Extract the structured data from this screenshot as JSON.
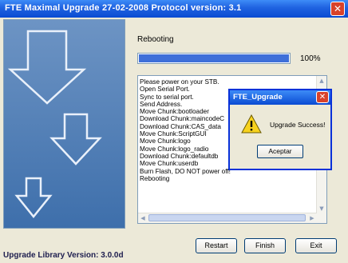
{
  "window": {
    "title": "FTE Maximal Upgrade   27-02-2008 Protocol version: 3.1",
    "close_glyph": "✕"
  },
  "status": {
    "label": "Rebooting",
    "progress_fraction": 1.0,
    "progress_text": "100%"
  },
  "log": {
    "lines": [
      "Please power on your STB.",
      "Open Serial Port.",
      "Sync to serial port.",
      "Send Address.",
      "Move Chunk:bootloader",
      "Download Chunk:maincodeC",
      "Download Chunk:CAS_data",
      "Move Chunk:ScriptGUI",
      "Move Chunk:logo",
      "Move Chunk:logo_radio",
      "Download Chunk:defaultdb",
      "Move Chunk:userdb",
      "Burn Flash, DO NOT power off!",
      "Rebooting"
    ]
  },
  "buttons": {
    "restart": "Restart",
    "finish": "Finish",
    "exit": "Exit"
  },
  "footer": {
    "library_version": "Upgrade Library Version: 3.0.0d"
  },
  "dialog": {
    "title": "FTE_Upgrade",
    "close_glyph": "✕",
    "message": "Upgrade Success!",
    "ok_label": "Aceptar",
    "icon": "warning-icon"
  },
  "colors": {
    "titlebar": "#0a4bd2",
    "progress_fill": "#3e6fd9",
    "close_button": "#d8422a"
  }
}
